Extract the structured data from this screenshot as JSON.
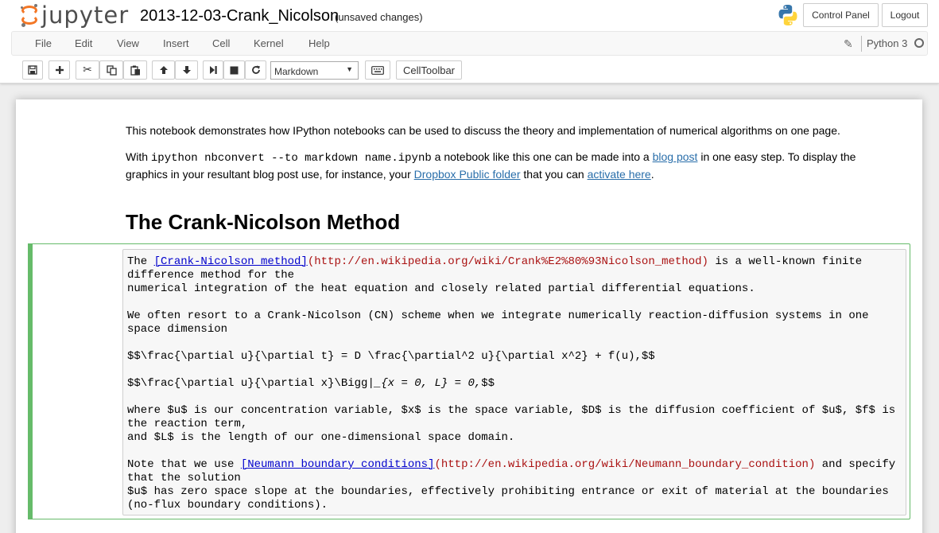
{
  "header": {
    "logo_text": "jupyter",
    "notebook_name": "2013-12-03-Crank_Nicolson",
    "save_status": "(unsaved changes)",
    "control_panel": "Control Panel",
    "logout": "Logout"
  },
  "menubar": {
    "items": [
      "File",
      "Edit",
      "View",
      "Insert",
      "Cell",
      "Kernel",
      "Help"
    ],
    "kernel_name": "Python 3"
  },
  "toolbar": {
    "cell_type": "Markdown",
    "cell_toolbar": "CellToolbar",
    "icons": [
      "save-icon",
      "plus-icon",
      "scissors-icon",
      "copy-icon",
      "paste-icon",
      "arrow-up-icon",
      "arrow-down-icon",
      "step-forward-icon",
      "stop-icon",
      "restart-icon",
      "keyboard-icon"
    ]
  },
  "rendered": {
    "p1": "This notebook demonstrates how IPython notebooks can be used to discuss the theory and implementation of numerical algorithms on one page.",
    "p2_a": "With ",
    "p2_code": "ipython nbconvert --to markdown name.ipynb",
    "p2_b": " a notebook like this one can be made into a ",
    "p2_link1": "blog post",
    "p2_c": " in one easy step. To display the graphics in your resultant blog post use, for instance, your ",
    "p2_link2": "Dropbox Public folder",
    "p2_d": " that you can ",
    "p2_link3": "activate here",
    "p2_e": ".",
    "heading": "The Crank-Nicolson Method"
  },
  "editor": {
    "l1_a": "The ",
    "l1_link": "[Crank-Nicolson method]",
    "l1_url": "(http://en.wikipedia.org/wiki/Crank%E2%80%93Nicolson_method)",
    "l1_b": " is a well-known finite",
    "l2": "difference method for the",
    "l3": "numerical integration of the heat equation and closely related partial differential equations.",
    "l5": "We often resort to a Crank-Nicolson (CN) scheme when we integrate numerically reaction-diffusion systems in one",
    "l6": "space dimension",
    "l8": "$$\\frac{\\partial u}{\\partial t} = D \\frac{\\partial^2 u}{\\partial x^2} + f(u),$$",
    "l10_a": "$$\\frac{\\partial u}{\\partial x}\\Bigg|",
    "l10_em": "_{x = 0, L} = 0,",
    "l10_b": "$$",
    "l12": "where $u$ is our concentration variable, $x$ is the space variable, $D$ is the diffusion coefficient of $u$, $f$ is",
    "l13": "the reaction term,",
    "l14": "and $L$ is the length of our one-dimensional space domain.",
    "l16_a": "Note that we use ",
    "l16_link": "[Neumann boundary conditions]",
    "l16_url": "(http://en.wikipedia.org/wiki/Neumann_boundary_condition)",
    "l16_b": " and specify",
    "l17": "that the solution",
    "l18": "$u$ has zero space slope at the boundaries, effectively prohibiting entrance or exit of material at the boundaries",
    "l19": "(no-flux boundary conditions)."
  },
  "colors": {
    "accent": "#f37726",
    "edit_mode": "#66bb6a",
    "link": "#296eaa",
    "cm_link": "#0000cc",
    "cm_url": "#aa1111"
  }
}
